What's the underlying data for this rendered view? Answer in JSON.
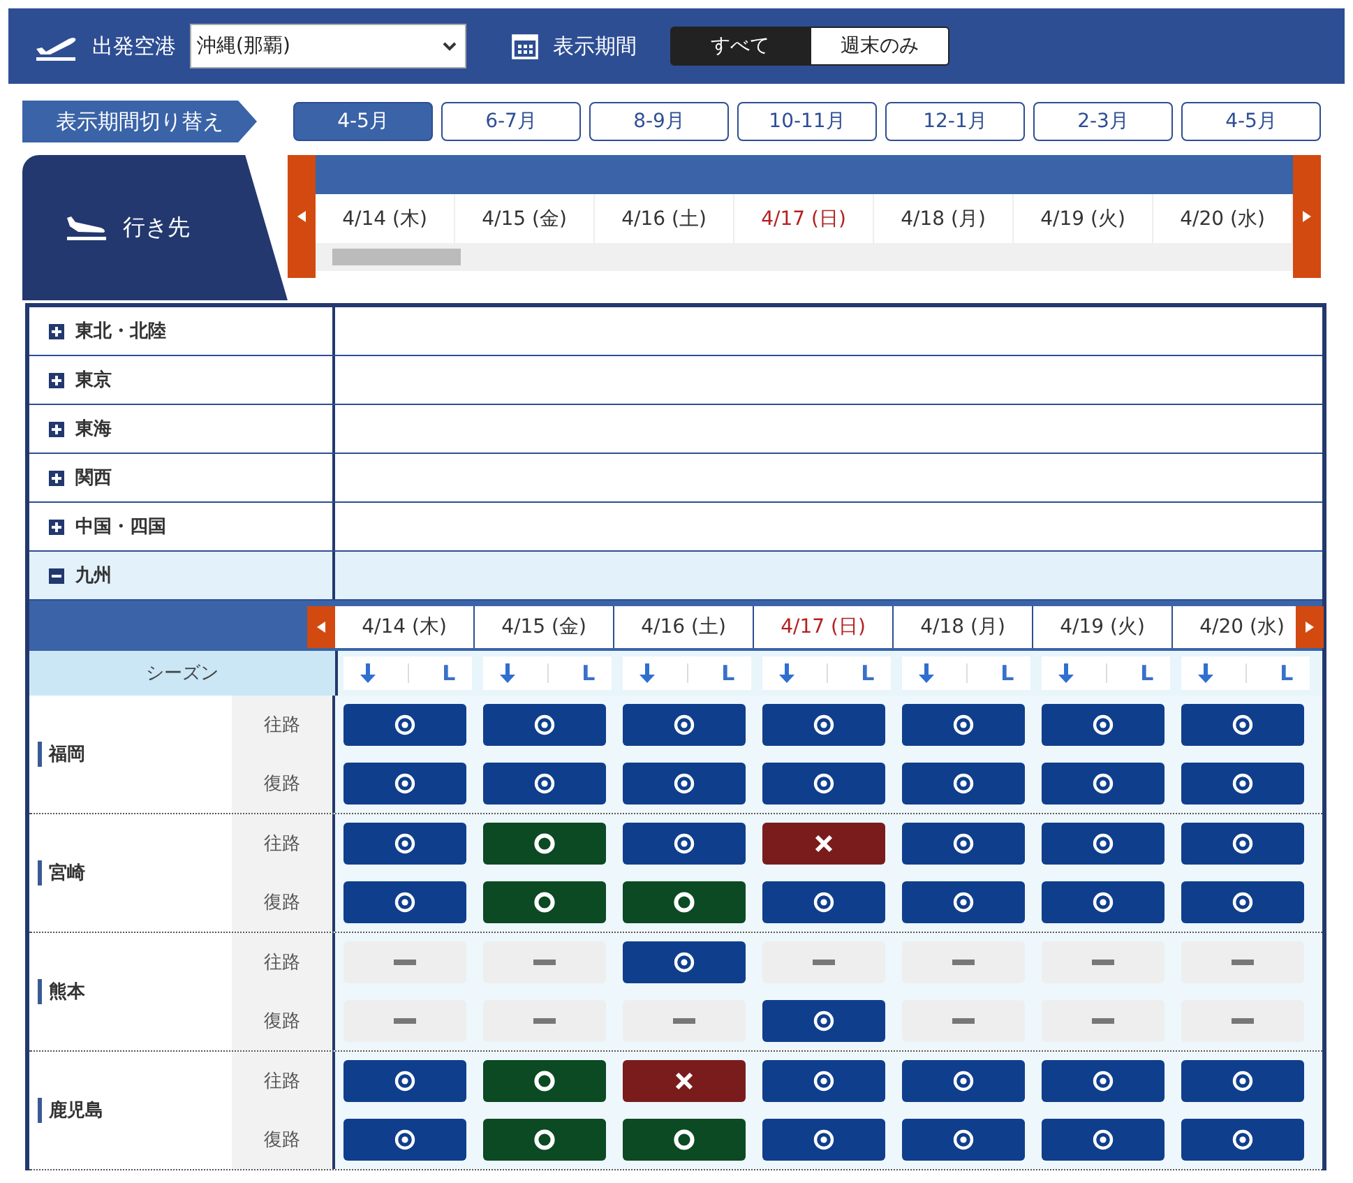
{
  "header": {
    "departure_label": "出発空港",
    "departure_value": "沖縄(那覇)",
    "period_label": "表示期間",
    "period_options": [
      {
        "label": "すべて",
        "selected": true
      },
      {
        "label": "週末のみ",
        "selected": false
      }
    ]
  },
  "period_switch": {
    "label": "表示期間切り替え",
    "options": [
      {
        "label": "4-5月",
        "selected": true
      },
      {
        "label": "6-7月",
        "selected": false
      },
      {
        "label": "8-9月",
        "selected": false
      },
      {
        "label": "10-11月",
        "selected": false
      },
      {
        "label": "12-1月",
        "selected": false
      },
      {
        "label": "2-3月",
        "selected": false
      },
      {
        "label": "4-5月",
        "selected": false
      }
    ]
  },
  "destination_label": "行き先",
  "top_dates": [
    {
      "label": "4/14 (木)",
      "sunday": false
    },
    {
      "label": "4/15 (金)",
      "sunday": false
    },
    {
      "label": "4/16 (土)",
      "sunday": false
    },
    {
      "label": "4/17 (日)",
      "sunday": true
    },
    {
      "label": "4/18 (月)",
      "sunday": false
    },
    {
      "label": "4/19 (火)",
      "sunday": false
    },
    {
      "label": "4/20 (水)",
      "sunday": false
    }
  ],
  "regions": [
    {
      "name": "東北・北陸",
      "expanded": false
    },
    {
      "name": "東京",
      "expanded": false
    },
    {
      "name": "東海",
      "expanded": false
    },
    {
      "name": "関西",
      "expanded": false
    },
    {
      "name": "中国・四国",
      "expanded": false
    },
    {
      "name": "九州",
      "expanded": true
    }
  ],
  "detail": {
    "season_label": "シーズン",
    "dates": [
      {
        "label": "4/14 (木)",
        "sunday": false,
        "season": "L"
      },
      {
        "label": "4/15 (金)",
        "sunday": false,
        "season": "L"
      },
      {
        "label": "4/16 (土)",
        "sunday": false,
        "season": "L"
      },
      {
        "label": "4/17 (日)",
        "sunday": true,
        "season": "L"
      },
      {
        "label": "4/18 (月)",
        "sunday": false,
        "season": "L"
      },
      {
        "label": "4/19 (火)",
        "sunday": false,
        "season": "L"
      },
      {
        "label": "4/20 (水)",
        "sunday": false,
        "season": "L"
      }
    ],
    "cities": [
      {
        "name": "福岡",
        "legs": [
          {
            "label": "往路",
            "cells": [
              {
                "kind": "double"
              },
              {
                "kind": "double"
              },
              {
                "kind": "double"
              },
              {
                "kind": "double"
              },
              {
                "kind": "double"
              },
              {
                "kind": "double"
              },
              {
                "kind": "double"
              }
            ]
          },
          {
            "label": "復路",
            "cells": [
              {
                "kind": "double"
              },
              {
                "kind": "double"
              },
              {
                "kind": "double"
              },
              {
                "kind": "double"
              },
              {
                "kind": "double"
              },
              {
                "kind": "double"
              },
              {
                "kind": "double"
              }
            ]
          }
        ]
      },
      {
        "name": "宮崎",
        "legs": [
          {
            "label": "往路",
            "cells": [
              {
                "kind": "double"
              },
              {
                "kind": "single"
              },
              {
                "kind": "double"
              },
              {
                "kind": "none"
              },
              {
                "kind": "double"
              },
              {
                "kind": "double"
              },
              {
                "kind": "double"
              }
            ]
          },
          {
            "label": "復路",
            "cells": [
              {
                "kind": "double"
              },
              {
                "kind": "single"
              },
              {
                "kind": "single"
              },
              {
                "kind": "double"
              },
              {
                "kind": "double"
              },
              {
                "kind": "double"
              },
              {
                "kind": "double"
              }
            ]
          }
        ]
      },
      {
        "name": "熊本",
        "legs": [
          {
            "label": "往路",
            "cells": [
              {
                "kind": "na"
              },
              {
                "kind": "na"
              },
              {
                "kind": "double"
              },
              {
                "kind": "na"
              },
              {
                "kind": "na"
              },
              {
                "kind": "na"
              },
              {
                "kind": "na"
              }
            ]
          },
          {
            "label": "復路",
            "cells": [
              {
                "kind": "na"
              },
              {
                "kind": "na"
              },
              {
                "kind": "na"
              },
              {
                "kind": "double"
              },
              {
                "kind": "na"
              },
              {
                "kind": "na"
              },
              {
                "kind": "na"
              }
            ]
          }
        ]
      },
      {
        "name": "鹿児島",
        "legs": [
          {
            "label": "往路",
            "cells": [
              {
                "kind": "double"
              },
              {
                "kind": "single"
              },
              {
                "kind": "none"
              },
              {
                "kind": "double"
              },
              {
                "kind": "double"
              },
              {
                "kind": "double"
              },
              {
                "kind": "double"
              }
            ]
          },
          {
            "label": "復路",
            "cells": [
              {
                "kind": "double"
              },
              {
                "kind": "single"
              },
              {
                "kind": "single"
              },
              {
                "kind": "double"
              },
              {
                "kind": "double"
              },
              {
                "kind": "double"
              },
              {
                "kind": "double"
              }
            ]
          }
        ]
      }
    ]
  }
}
